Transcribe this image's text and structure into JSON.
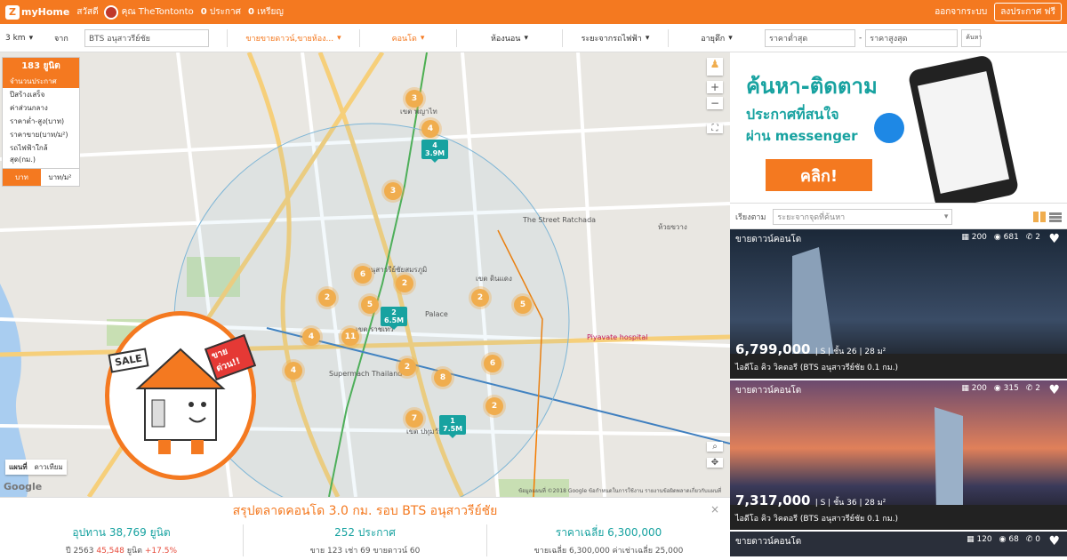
{
  "topbar": {
    "logo_text": "myHome",
    "greeting": "สวัสดี",
    "user": "คุณ TheTontonto",
    "stat1_value": "0",
    "stat1_label": "ประกาศ",
    "stat2_value": "0",
    "stat2_label": "เหรียญ",
    "logout": "ออกจากระบบ",
    "post_button": "ลงประกาศ ฟรี"
  },
  "filters": {
    "radius": "3 km",
    "from_label": "จาก",
    "from_value": "BTS อนุสาวรีย์ชัย",
    "type": "ขายขายดาวน์,ขายห้อง...",
    "category": "คอนโด",
    "rooms": "ห้องนอน",
    "distance": "ระยะจากรถไฟฟ้า",
    "age": "อายุตึก",
    "price_min_placeholder": "ราคาต่ำสุด",
    "dash": "-",
    "price_max_placeholder": "ราคาสูงสุด",
    "search_button": "ค้นหา"
  },
  "sidepanel": {
    "header": "183 ยูนิต",
    "items": [
      "จำนวนประกาศ",
      "ปีสร้างเสร็จ",
      "ค่าส่วนกลาง",
      "ราคาต่ำ-สูง(บาท)",
      "ราคาขาย(บาท/ม²)",
      "รถไฟฟ้าใกล้สุด(กม.)"
    ],
    "toggle_a": "บาท",
    "toggle_b": "บาท/ม²"
  },
  "map": {
    "clusters": [
      {
        "n": "3"
      },
      {
        "n": "4"
      },
      {
        "n": "3"
      },
      {
        "n": "6"
      },
      {
        "n": "2"
      },
      {
        "n": "2"
      },
      {
        "n": "5"
      },
      {
        "n": "2"
      },
      {
        "n": "5"
      },
      {
        "n": "4"
      },
      {
        "n": "11"
      },
      {
        "n": "4"
      },
      {
        "n": "2"
      },
      {
        "n": "6"
      },
      {
        "n": "8"
      },
      {
        "n": "2"
      },
      {
        "n": "7"
      }
    ],
    "price_tags": [
      {
        "count": "4",
        "price": "3.9M"
      },
      {
        "count": "2",
        "price": "6.5M"
      },
      {
        "count": "1",
        "price": "7.5M"
      }
    ],
    "labels": {
      "l1": "The Street Ratchada",
      "l2": "Palace",
      "l3": "Piyavate hospital",
      "l4": "Supermach Thailand",
      "l5": "เขต ดินแดง",
      "l6": "อนุสาวรีย์ชัยสมรภูมิ",
      "l7": "เขต ราชเทวี",
      "l8": "เขต ปทุมวัน",
      "l9": "เขต พญาไท",
      "l10": "ห้วยขวาง"
    },
    "mascot_sale": "SALE",
    "mascot_urgent": "ขายด่วน!!",
    "map_type_1": "แผนที่",
    "map_type_2": "ดาวเทียม",
    "google": "Google",
    "attribution": "ข้อมูลแผนที่ ©2018 Google   ข้อกำหนดในการใช้งาน   รายงานข้อผิดพลาดเกี่ยวกับแผนที่"
  },
  "summary": {
    "title": "สรุปตลาดคอนโด 3.0 กม. รอบ BTS อนุสาวรีย์ชัย",
    "col1_big": "อุปทาน 38,769 ยูนิต",
    "col1_small_a": "ปี 2563",
    "col1_small_red": "45,548",
    "col1_small_b": "ยูนิต",
    "col1_small_pct": "+17.5%",
    "col2_big": "252 ประกาศ",
    "col2_small": "ขาย 123  เช่า 69  ขายดาวน์ 60",
    "col3_big": "ราคาเฉลี่ย 6,300,000",
    "col3_small": "ขายเฉลี่ย 6,300,000 ค่าเช่าเฉลี่ย 25,000",
    "close": "×"
  },
  "ad": {
    "line1": "ค้นหา-ติดตาม",
    "line2": "ประกาศที่สนใจ",
    "line3": "ผ่าน messenger",
    "button": "คลิก!"
  },
  "sort": {
    "label": "เรียงตาม",
    "placeholder": "ระยะจากจุดที่ค้นหา"
  },
  "listings": [
    {
      "type": "ขายดาวน์คอนโด",
      "photos": "200",
      "views": "681",
      "calls": "2",
      "price": "6,799,000",
      "details": "| S | ชั้น 26 | 28 ม²",
      "name": "ไอดีโอ คิว วิคตอรี (BTS อนุสาวรีย์ชัย 0.1 กม.)"
    },
    {
      "type": "ขายดาวน์คอนโด",
      "photos": "200",
      "views": "315",
      "calls": "2",
      "price": "7,317,000",
      "details": "| S | ชั้น 36 | 28 ม²",
      "name": "ไอดีโอ คิว วิคตอรี (BTS อนุสาวรีย์ชัย 0.1 กม.)"
    },
    {
      "type": "ขายดาวน์คอนโด",
      "photos": "120",
      "views": "68",
      "calls": "0"
    }
  ],
  "colors": {
    "brand_orange": "#f47920",
    "teal": "#17a2a0",
    "cluster": "#f0ad4e"
  }
}
